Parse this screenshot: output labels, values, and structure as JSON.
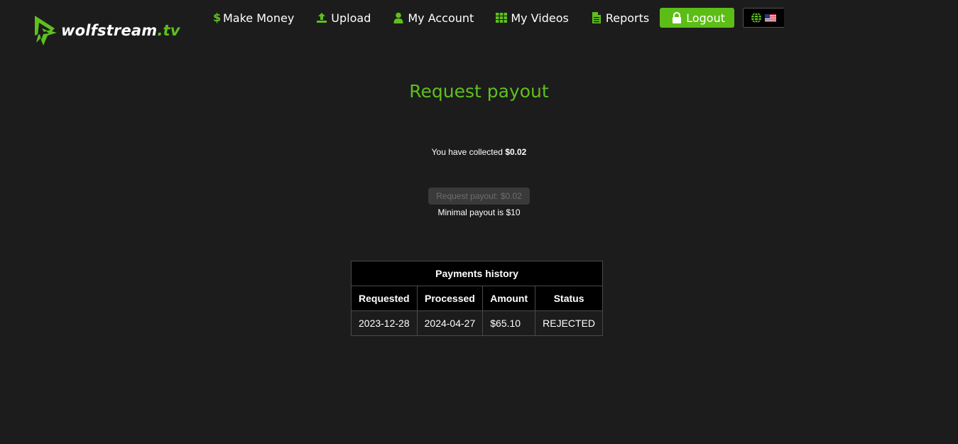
{
  "brand": {
    "name": "wolfstream",
    "tld": ".tv",
    "accent_color": "#5fbf1f"
  },
  "nav": {
    "items": [
      {
        "label": "Make Money",
        "icon": "dollar-icon"
      },
      {
        "label": "Upload",
        "icon": "upload-icon"
      },
      {
        "label": "My Account",
        "icon": "user-icon"
      },
      {
        "label": "My Videos",
        "icon": "grid-icon"
      },
      {
        "label": "Reports",
        "icon": "document-icon"
      }
    ],
    "logout_label": "Logout",
    "logout_icon": "lock-icon",
    "language_icons": [
      "globe-icon",
      "us-flag-icon"
    ]
  },
  "payout": {
    "title": "Request payout",
    "collected_prefix": "You have collected",
    "collected_amount": "$0.02",
    "request_button_label": "Request payout: $0.02",
    "minimal_note": "Minimal payout is $10"
  },
  "history": {
    "caption": "Payments history",
    "columns": [
      "Requested",
      "Processed",
      "Amount",
      "Status"
    ],
    "rows": [
      [
        "2023-12-28",
        "2024-04-27",
        "$65.10",
        "REJECTED"
      ]
    ]
  }
}
